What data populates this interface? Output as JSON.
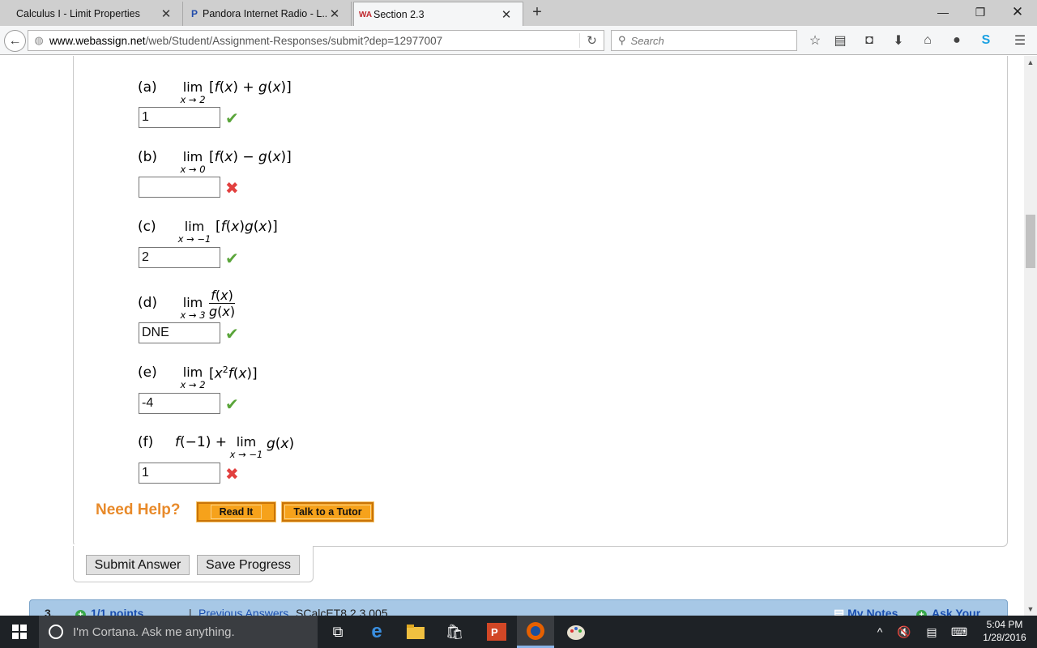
{
  "browser": {
    "tabs": [
      {
        "title": "Calculus I - Limit Properties",
        "active": false
      },
      {
        "title": "Pandora Internet Radio - L...",
        "active": false,
        "favicon": "P"
      },
      {
        "title": "Section 2.3",
        "active": true,
        "favicon": "WA"
      }
    ],
    "url_domain": "www.webassign.net",
    "url_path": "/web/Student/Assignment-Responses/submit?dep=12977007",
    "search_placeholder": "Search"
  },
  "question": {
    "parts": [
      {
        "label": "(a)",
        "lim": "lim",
        "sub": "x → 2",
        "answer": "1",
        "status": "correct"
      },
      {
        "label": "(b)",
        "lim": "lim",
        "sub": "x → 0",
        "answer": "",
        "status": "incorrect"
      },
      {
        "label": "(c)",
        "lim": "lim",
        "sub": "x → −1",
        "answer": "2",
        "status": "correct"
      },
      {
        "label": "(d)",
        "lim": "lim",
        "sub": "x → 3",
        "answer": "DNE",
        "status": "correct"
      },
      {
        "label": "(e)",
        "lim": "lim",
        "sub": "x → 2",
        "answer": "-4",
        "status": "correct"
      },
      {
        "label": "(f)",
        "lim": "lim",
        "sub": "x → −1",
        "answer": "1",
        "status": "incorrect"
      }
    ],
    "need_help": "Need Help?",
    "read_it": "Read It",
    "talk_to_tutor": "Talk to a Tutor",
    "submit": "Submit Answer",
    "save": "Save Progress"
  },
  "next_question": {
    "number": "3.",
    "points": "1/1 points",
    "separator": "|",
    "previous_answers": "Previous Answers",
    "code": "SCalcET8 2.3.005.",
    "my_notes": "My Notes",
    "ask_teacher": "Ask Your Teacher"
  },
  "taskbar": {
    "cortana_placeholder": "I'm Cortana. Ask me anything.",
    "time": "5:04 PM",
    "date": "1/28/2016"
  },
  "colors": {
    "correct": "#5aa53a",
    "incorrect": "#e2403f",
    "need_help": "#e88a2a",
    "help_button": "#f6a21b",
    "next_bar": "#a7c8e6",
    "link": "#1a4fb0"
  }
}
